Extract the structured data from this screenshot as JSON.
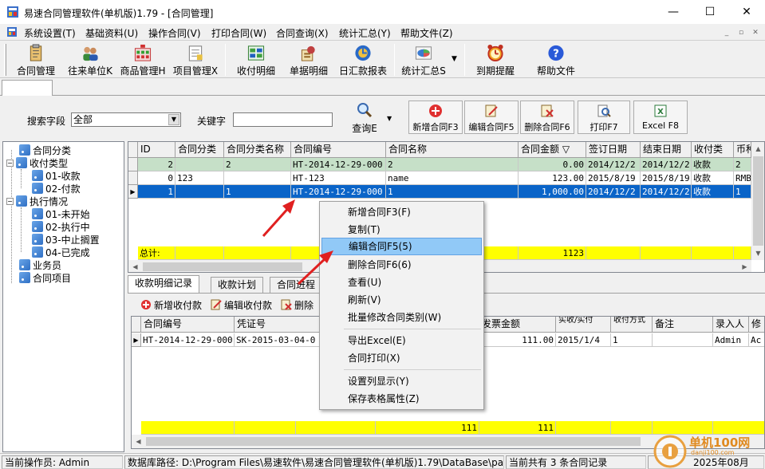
{
  "window": {
    "title": "易速合同管理软件(单机版)1.79 - [合同管理]",
    "controls": [
      "—",
      "☐",
      "✕"
    ]
  },
  "menu": [
    "系统设置(T)",
    "基础资料(U)",
    "操作合同(V)",
    "打印合同(W)",
    "合同查询(X)",
    "统计汇总(Y)",
    "帮助文件(Z)"
  ],
  "mdi_controls": [
    "_",
    "▫",
    "✕"
  ],
  "toolbar": [
    {
      "label": "合同管理",
      "icon": "clipboard-icon"
    },
    {
      "label": "往来单位K",
      "icon": "users-icon"
    },
    {
      "label": "商品管理H",
      "icon": "products-icon"
    },
    {
      "label": "项目管理X",
      "icon": "folder-icon"
    },
    {
      "label": "收付明细",
      "icon": "cash-icon"
    },
    {
      "label": "单据明细",
      "icon": "receipt-icon"
    },
    {
      "label": "日汇款报表",
      "icon": "calendar-icon"
    },
    {
      "label": "统计汇总S",
      "icon": "chart-icon"
    },
    {
      "label": "到期提醒",
      "icon": "alarm-clock-icon"
    },
    {
      "label": "帮助文件",
      "icon": "help-icon"
    }
  ],
  "search": {
    "field_label": "搜索字段",
    "field_value": "全部",
    "keyword_label": "关键字",
    "keyword_value": "",
    "query_label": "查询E"
  },
  "actions": [
    {
      "label": "新增合同F3",
      "icon": "add-icon"
    },
    {
      "label": "编辑合同F5",
      "icon": "edit-icon"
    },
    {
      "label": "删除合同F6",
      "icon": "delete-icon"
    },
    {
      "label": "打印F7",
      "icon": "print-icon"
    },
    {
      "label": "Excel F8",
      "icon": "excel-icon"
    }
  ],
  "tree": [
    {
      "label": "合同分类",
      "level": 0,
      "expander": ""
    },
    {
      "label": "收付类型",
      "level": 0,
      "expander": "−"
    },
    {
      "label": "01-收款",
      "level": 1,
      "expander": ""
    },
    {
      "label": "02-付款",
      "level": 1,
      "expander": ""
    },
    {
      "label": "执行情况",
      "level": 0,
      "expander": "−"
    },
    {
      "label": "01-未开始",
      "level": 1,
      "expander": ""
    },
    {
      "label": "02-执行中",
      "level": 1,
      "expander": ""
    },
    {
      "label": "03-中止搁置",
      "level": 1,
      "expander": ""
    },
    {
      "label": "04-已完成",
      "level": 1,
      "expander": ""
    },
    {
      "label": "业务员",
      "level": 0,
      "expander": ""
    },
    {
      "label": "合同项目",
      "level": 0,
      "expander": ""
    }
  ],
  "contracts": {
    "columns": [
      "ID",
      "合同分类",
      "合同分类名称",
      "合同编号",
      "合同名称",
      "合同金额 ▽",
      "签订日期",
      "结束日期",
      "收付类",
      "币种"
    ],
    "rows": [
      {
        "id": "2",
        "cat": "",
        "catname": "2",
        "no": "HT-2014-12-29-000",
        "name": "2",
        "amount": "0.00",
        "sign": "2014/12/2",
        "end": "2014/12/2",
        "type": "收款",
        "cur": "2"
      },
      {
        "id": "0",
        "cat": "123",
        "catname": "",
        "no": "HT-123",
        "name": "name",
        "amount": "123.00",
        "sign": "2015/8/19",
        "end": "2015/8/19",
        "type": "收款",
        "cur": "RMB"
      },
      {
        "id": "1",
        "cat": "",
        "catname": "1",
        "no": "HT-2014-12-29-000",
        "name": "1",
        "amount": "1,000.00",
        "sign": "2014/12/2",
        "end": "2014/12/2",
        "type": "收款",
        "cur": "1"
      }
    ],
    "total_label": "总计:",
    "total_amount": "1123"
  },
  "subtabs": [
    "收款明细记录",
    "收款计划",
    "合同进程"
  ],
  "subtools": [
    {
      "label": "新增收付款",
      "icon": "add-icon"
    },
    {
      "label": "编辑收付款",
      "icon": "edit-icon"
    },
    {
      "label": "删除",
      "icon": "delete-icon"
    }
  ],
  "payments": {
    "columns": [
      "合同编号",
      "凭证号",
      "发票金额",
      "实收/实付",
      "收付方式",
      "备注",
      "录入人",
      "修"
    ],
    "rows": [
      {
        "no": "HT-2014-12-29-000",
        "voucher": "SK-2015-03-04-0",
        "invoice": "111.00",
        "date": "2015/1/4",
        "method": "1",
        "note": "",
        "user": "Admin",
        "mod": "Ac"
      }
    ],
    "totals": [
      "111",
      "111"
    ]
  },
  "context_menu": [
    {
      "label": "新增合同F3(F)",
      "highlight": false
    },
    {
      "label": "复制(T)",
      "highlight": false
    },
    {
      "label": "编辑合同F5(5)",
      "highlight": true
    },
    {
      "label": "删除合同F6(6)",
      "highlight": false
    },
    {
      "label": "查看(U)",
      "highlight": false
    },
    {
      "label": "刷新(V)",
      "highlight": false
    },
    {
      "label": "批量修改合同类别(W)",
      "highlight": false
    },
    {
      "label": "导出Excel(E)",
      "highlight": false
    },
    {
      "label": "合同打印(X)",
      "highlight": false
    },
    {
      "label": "设置列显示(Y)",
      "highlight": false
    },
    {
      "label": "保存表格属性(Z)",
      "highlight": false
    }
  ],
  "status": {
    "operator": "当前操作员: Admin",
    "db_path": "数据库路径:  D:\\Program Files\\易速软件\\易速合同管理软件(单机版)1.79\\DataBase\\pa",
    "count": "当前共有 3 条合同记录",
    "date": "2025年08月"
  },
  "watermark": {
    "site": "单机100网",
    "domain": "danji100.com"
  },
  "colors": {
    "selection": "#0a64c8",
    "highlight_row": "#c6e0c8",
    "total_row": "#ffff00",
    "menu_highlight": "#91c9f7",
    "arrow": "#e02020"
  }
}
